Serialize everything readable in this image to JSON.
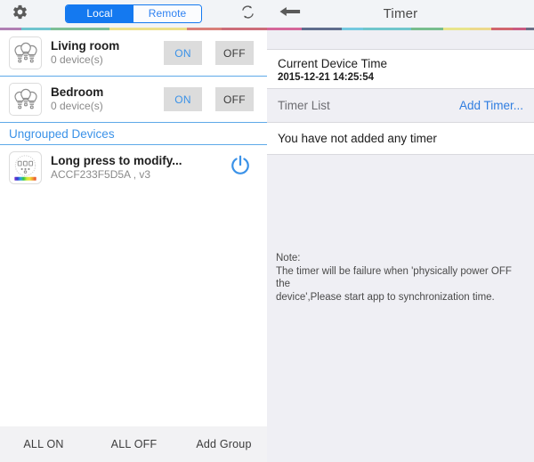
{
  "left": {
    "topbar": {
      "gear_icon": "gear-icon",
      "refresh_icon": "refresh-icon",
      "segments": [
        {
          "label": "Local",
          "active": true
        },
        {
          "label": "Remote",
          "active": false
        }
      ]
    },
    "groups": [
      {
        "icon": "three-bulbs-icon",
        "name": "Living room",
        "subtitle": "0 device(s)",
        "on_label": "ON",
        "off_label": "OFF"
      },
      {
        "icon": "three-bulbs-icon",
        "name": "Bedroom",
        "subtitle": "0 device(s)",
        "on_label": "ON",
        "off_label": "OFF"
      }
    ],
    "section_header": "Ungrouped Devices",
    "devices": [
      {
        "icon": "rgb-controller-icon",
        "name": "Long press to modify...",
        "subtitle": "ACCF233F5D5A , v3",
        "power_icon": "power-icon"
      }
    ],
    "bottombar": {
      "all_on": "ALL ON",
      "all_off": "ALL OFF",
      "add_group": "Add Group"
    }
  },
  "right": {
    "topbar": {
      "back_icon": "back-arrow-icon",
      "title": "Timer"
    },
    "current_device_time": {
      "label": "Current Device Time",
      "value": "2015-12-21 14:25:54"
    },
    "timer_list": {
      "label": "Timer List",
      "add_link": "Add Timer..."
    },
    "empty_state": "You have not added any timer",
    "note": {
      "heading": "Note:",
      "line1": "The timer will be failure when 'physically power OFF the",
      "line2": "device',Please start app to synchronization time."
    }
  },
  "colors": {
    "accent_blue": "#1479f0",
    "link_blue": "#2f7de0",
    "panel_gray": "#efeff4",
    "topbar_gray": "#f2f4f7"
  }
}
